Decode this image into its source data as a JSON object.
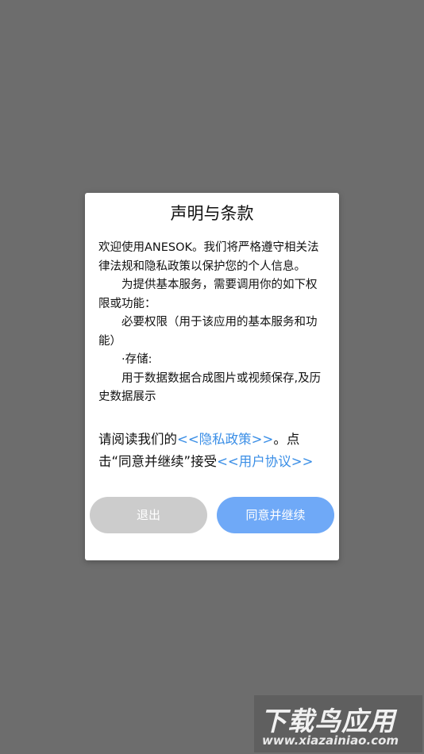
{
  "dialog": {
    "title": "声明与条款",
    "body": [
      "欢迎使用ANESOK。我们将严格遵守相关法律法规和隐私政策以保护您的个人信息。",
      "为提供基本服务，需要调用你的如下权限或功能：",
      "必要权限（用于该应用的基本服务和功能）",
      "·存储:",
      "用于数据数据合成图片或视频保存,及历史数据展示"
    ],
    "notice": {
      "prefix": "请阅读我们的",
      "privacy_link": "<<隐私政策>>",
      "middle": "。点击“同意并继续”接受",
      "agreement_link": "<<用户协议>>"
    },
    "exit_button": "退出",
    "agree_button": "同意并继续"
  },
  "watermark": {
    "logo": "下载鸟应用",
    "url": "www.xiazainiao.com"
  },
  "colors": {
    "overlay": "#6d6d6d",
    "link": "#3a8ee6",
    "exit_button": "#cccccc",
    "agree_button": "#6fa9f7"
  }
}
